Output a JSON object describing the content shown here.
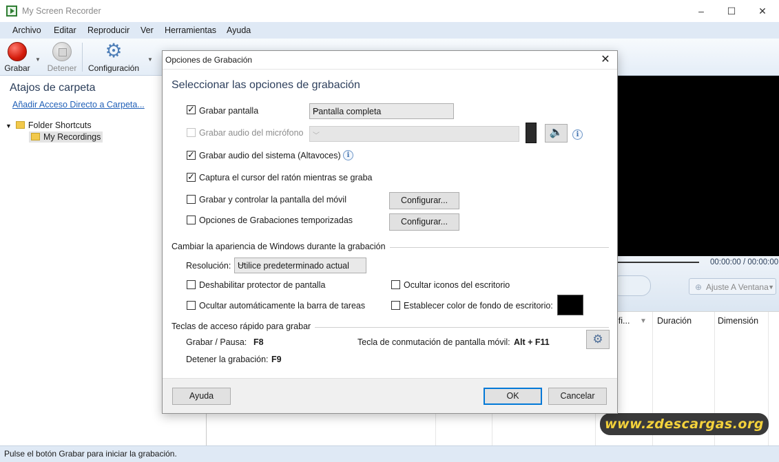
{
  "window": {
    "title": "My Screen Recorder",
    "minimize": "–",
    "maximize": "☐",
    "close": "✕"
  },
  "menu": [
    "Archivo",
    "Editar",
    "Reproducir",
    "Ver",
    "Herramientas",
    "Ayuda"
  ],
  "toolbar": {
    "record": "Grabar",
    "stop": "Detener",
    "config": "Configuración"
  },
  "sidebar": {
    "heading": "Atajos de carpeta",
    "add_link": "Añadir Acceso Directo a Carpeta...",
    "tree_root": "Folder Shortcuts",
    "tree_child": "My Recordings"
  },
  "player": {
    "time": "00:00:00 / 00:00:00",
    "fit_button": "Ajuste A Ventana"
  },
  "list": {
    "columns": [
      "ifi...",
      "Duración",
      "Dimensión"
    ]
  },
  "status": "Pulse el botón Grabar para iniciar la grabación.",
  "watermark": "www.zdescargas.org",
  "dialog": {
    "title": "Opciones de Grabación",
    "close": "✕",
    "heading": "Seleccionar las opciones de grabación",
    "options": {
      "record_screen": {
        "label": "Grabar pantalla",
        "checked": true,
        "value": "Pantalla completa"
      },
      "mic_audio": {
        "label": "Grabar audio del micrófono",
        "checked": false,
        "enabled": false
      },
      "system_audio": {
        "label": "Grabar audio del sistema (Altavoces)",
        "checked": true
      },
      "cursor": {
        "label": "Captura el cursor del ratón mientras se graba",
        "checked": true
      },
      "mobile": {
        "label": "Grabar y controlar la pantalla del móvil",
        "checked": false,
        "button": "Configurar..."
      },
      "scheduled": {
        "label": "Opciones de Grabaciones temporizadas",
        "checked": false,
        "button": "Configurar..."
      }
    },
    "appearance": {
      "group_title": "Cambiar la apariencia de Windows durante la grabación",
      "resolution_label": "Resolución:",
      "resolution_value": "Utilice predeterminado actual",
      "disable_screensaver": "Deshabilitar protector de pantalla",
      "hide_desktop_icons": "Ocultar iconos del escritorio",
      "autohide_taskbar": "Ocultar automáticamente la barra de tareas",
      "set_desktop_bg": "Establecer color de fondo de escritorio:",
      "bg_color": "#000000"
    },
    "hotkeys": {
      "group_title": "Teclas de acceso rápido para grabar",
      "record_pause_label": "Grabar / Pausa:",
      "record_pause_key": "F8",
      "mobile_toggle_label": "Tecla de conmutación de pantalla móvil:",
      "mobile_toggle_key": "Alt + F11",
      "stop_label": "Detener la grabación:",
      "stop_key": "F9"
    },
    "buttons": {
      "help": "Ayuda",
      "ok": "OK",
      "cancel": "Cancelar"
    }
  }
}
